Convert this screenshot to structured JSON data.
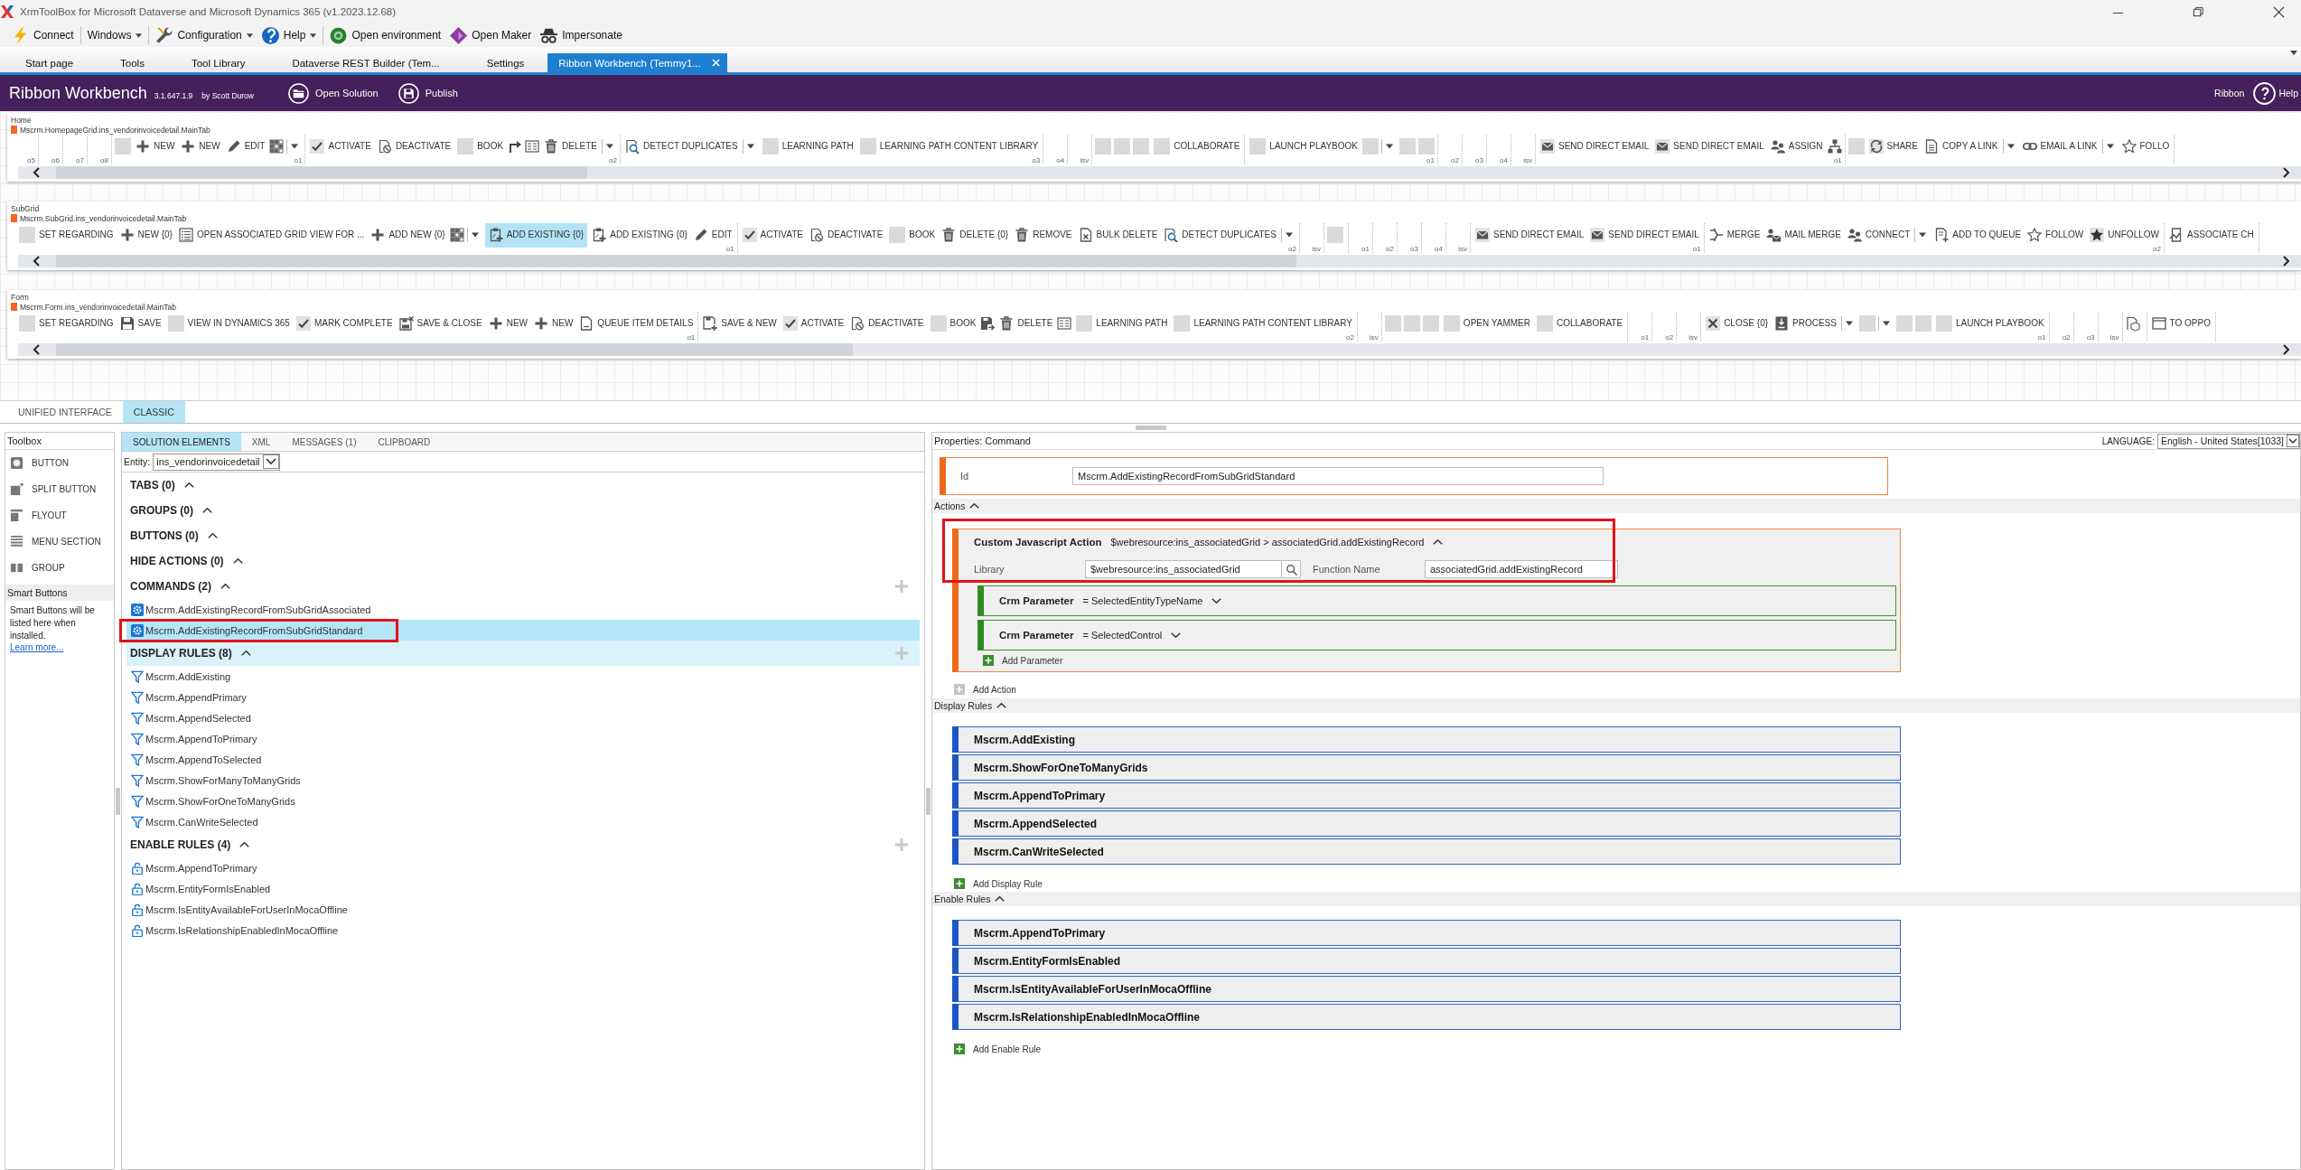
{
  "window": {
    "title": "XrmToolBox for Microsoft Dataverse and Microsoft Dynamics 365 (v1.2023.12.68)"
  },
  "toolbar": [
    {
      "items": [
        {
          "kind": "bolt",
          "label": "Connect",
          "menu": false
        }
      ]
    },
    {
      "items": [
        {
          "kind": "text",
          "label": "Windows",
          "menu": true
        }
      ]
    },
    {
      "items": [
        {
          "kind": "wrench",
          "label": "Configuration",
          "menu": true
        },
        {
          "kind": "help",
          "label": "Help",
          "menu": true
        }
      ]
    },
    {
      "items": [
        {
          "kind": "environment",
          "label": "Open environment",
          "menu": false
        },
        {
          "kind": "maker",
          "label": "Open Maker",
          "menu": false
        },
        {
          "kind": "spy",
          "label": "Impersonate",
          "menu": false
        }
      ]
    }
  ],
  "tabs": [
    {
      "label": "Start page",
      "selected": false
    },
    {
      "label": "Tools",
      "selected": false
    },
    {
      "label": "Tool Library",
      "selected": false
    },
    {
      "label": "Dataverse REST Builder (Tem...",
      "selected": false
    },
    {
      "label": "Settings",
      "selected": false
    },
    {
      "label": "Ribbon Workbench (Temmy1...",
      "selected": true
    }
  ],
  "header": {
    "title": "Ribbon Workbench",
    "version": "3.1.647.1.9",
    "author": "by Scott Durow",
    "actions": [
      {
        "kind": "open",
        "label": "Open Solution"
      },
      {
        "kind": "publish",
        "label": "Publish"
      }
    ],
    "ribbon": "Ribbon",
    "help": "Help"
  },
  "ribbon_tabs": [
    {
      "title": "Home",
      "id": "Mscrm.HomepageGrid.ins_vendorinvoicedetail.MainTab",
      "groups": [
        {
          "label": "o5"
        },
        {
          "label": "o6"
        },
        {
          "label": "o7"
        },
        {
          "label": "o8"
        },
        {
          "label": "o1",
          "items": [
            {
              "kind": "blank",
              "selected": false
            },
            {
              "kind": "plus",
              "label": "NEW",
              "selected": false
            },
            {
              "kind": "plus",
              "label": "NEW",
              "selected": false
            },
            {
              "kind": "pencil",
              "label": "EDIT",
              "selected": false
            },
            {
              "kind": "grid",
              "selected": false
            },
            {
              "kind": "caret",
              "selected": false
            }
          ]
        },
        {
          "label": "o2",
          "items": [
            {
              "kind": "check",
              "label": "ACTIVATE",
              "selected": false
            },
            {
              "kind": "deactivate",
              "label": "DEACTIVATE",
              "selected": false
            },
            {
              "kind": "blank",
              "label": "BOOK",
              "selected": false
            },
            {
              "kind": "arrow",
              "selected": false
            },
            {
              "kind": "form",
              "selected": false
            },
            {
              "kind": "trash",
              "label": "DELETE",
              "selected": false
            },
            {
              "kind": "caret",
              "selected": false
            }
          ]
        },
        {
          "label": "o3",
          "items": [
            {
              "kind": "detect",
              "label": "DETECT DUPLICATES",
              "selected": false
            },
            {
              "kind": "caret",
              "selected": false
            },
            {
              "kind": "blank",
              "label": "LEARNING PATH",
              "selected": false
            },
            {
              "kind": "blank",
              "label": "LEARNING PATH CONTENT LIBRARY",
              "selected": false
            }
          ]
        },
        {
          "label": "o4"
        },
        {
          "label": "isv"
        },
        {
          "items": [
            {
              "kind": "blank",
              "selected": false
            },
            {
              "kind": "blank",
              "selected": false
            },
            {
              "kind": "blank",
              "selected": false
            },
            {
              "kind": "blank",
              "label": "COLLABORATE",
              "selected": false
            }
          ]
        },
        {
          "label": "o1",
          "items": [
            {
              "kind": "blank",
              "label": "LAUNCH PLAYBOOK",
              "selected": false
            },
            {
              "kind": "blank",
              "selected": false
            },
            {
              "kind": "caret",
              "selected": false
            },
            {
              "kind": "blank",
              "selected": false
            },
            {
              "kind": "blank",
              "selected": false
            }
          ]
        },
        {
          "label": "o2"
        },
        {
          "label": "o3"
        },
        {
          "label": "o4"
        },
        {
          "label": "isv"
        },
        {
          "label": "o1",
          "items": [
            {
              "kind": "mail",
              "label": "SEND DIRECT EMAIL",
              "selected": false
            },
            {
              "kind": "mail",
              "label": "SEND DIRECT EMAIL",
              "selected": false
            },
            {
              "kind": "assign",
              "label": "ASSIGN",
              "selected": false
            },
            {
              "kind": "hierarchy",
              "selected": false
            }
          ]
        },
        {
          "items": [
            {
              "kind": "blank",
              "selected": false
            },
            {
              "kind": "share",
              "label": "SHARE",
              "selected": false
            },
            {
              "kind": "copy",
              "label": "COPY A LINK",
              "selected": false
            },
            {
              "kind": "caret",
              "selected": false
            },
            {
              "kind": "link",
              "label": "EMAIL A LINK",
              "selected": false
            },
            {
              "kind": "caret",
              "selected": false
            },
            {
              "kind": "star",
              "label": "FOLLO",
              "selected": false
            }
          ]
        }
      ]
    },
    {
      "title": "SubGrid",
      "id": "Mscrm.SubGrid.ins_vendorinvoicedetail.MainTab",
      "groups": [
        {
          "label": "o1",
          "items": [
            {
              "kind": "blank",
              "label": "SET REGARDING",
              "selected": false
            },
            {
              "kind": "plus",
              "label": "NEW {0}",
              "selected": false
            },
            {
              "kind": "list",
              "label": "OPEN ASSOCIATED GRID VIEW FOR ...",
              "selected": false
            },
            {
              "kind": "plus",
              "label": "ADD NEW {0}",
              "selected": false
            },
            {
              "kind": "grid",
              "selected": false
            },
            {
              "kind": "caret",
              "selected": false
            },
            {
              "kind": "clipboard",
              "label": "ADD EXISTING {0}",
              "selected": true
            },
            {
              "kind": "clipboard",
              "label": "ADD EXISTING {0}",
              "selected": false
            },
            {
              "kind": "pencil",
              "label": "EDIT",
              "selected": false
            }
          ]
        },
        {
          "label": "o2",
          "items": [
            {
              "kind": "check",
              "label": "ACTIVATE",
              "selected": false
            },
            {
              "kind": "deactivate",
              "label": "DEACTIVATE",
              "selected": false
            },
            {
              "kind": "blank",
              "label": "BOOK",
              "selected": false
            },
            {
              "kind": "trash",
              "label": "DELETE {0}",
              "selected": false
            },
            {
              "kind": "trash",
              "label": "REMOVE",
              "selected": false
            },
            {
              "kind": "bulk",
              "label": "BULK DELETE",
              "selected": false
            },
            {
              "kind": "detect",
              "label": "DETECT DUPLICATES",
              "selected": false
            },
            {
              "kind": "caret",
              "selected": false
            }
          ]
        },
        {
          "label": "isv"
        },
        {
          "items": [
            {
              "kind": "blank",
              "selected": false
            }
          ]
        },
        {
          "label": "o1"
        },
        {
          "label": "o2"
        },
        {
          "label": "o3"
        },
        {
          "label": "o4"
        },
        {
          "label": "isv"
        },
        {
          "label": "o1",
          "items": [
            {
              "kind": "mail",
              "label": "SEND DIRECT EMAIL",
              "selected": false
            },
            {
              "kind": "mail",
              "label": "SEND DIRECT EMAIL",
              "selected": false
            }
          ]
        },
        {
          "label": "o2",
          "items": [
            {
              "kind": "merge",
              "label": "MERGE",
              "selected": false
            },
            {
              "kind": "mailmerge",
              "label": "MAIL MERGE",
              "selected": false
            },
            {
              "kind": "connect",
              "label": "CONNECT",
              "selected": false
            },
            {
              "kind": "caret",
              "selected": false
            },
            {
              "kind": "queue",
              "label": "ADD TO QUEUE",
              "selected": false
            },
            {
              "kind": "star",
              "label": "FOLLOW",
              "selected": false
            },
            {
              "kind": "starfill",
              "label": "UNFOLLOW",
              "selected": false
            }
          ]
        },
        {
          "items": [
            {
              "kind": "associate",
              "label": "ASSOCIATE CH",
              "selected": false
            }
          ]
        }
      ]
    },
    {
      "title": "Form",
      "id": "Mscrm.Form.ins_vendorinvoicedetail.MainTab",
      "groups": [
        {
          "label": "o1",
          "items": [
            {
              "kind": "blank",
              "label": "SET REGARDING",
              "selected": false
            },
            {
              "kind": "save",
              "label": "SAVE",
              "selected": false
            },
            {
              "kind": "blank",
              "label": "VIEW IN DYNAMICS 365",
              "selected": false
            },
            {
              "kind": "check",
              "label": "MARK COMPLETE",
              "selected": false
            },
            {
              "kind": "saveclose",
              "label": "SAVE & CLOSE",
              "selected": false
            },
            {
              "kind": "plus",
              "label": "NEW",
              "selected": false
            },
            {
              "kind": "plus",
              "label": "NEW",
              "selected": false
            },
            {
              "kind": "doc",
              "label": "QUEUE ITEM DETAILS",
              "selected": false
            }
          ]
        },
        {
          "label": "o2",
          "items": [
            {
              "kind": "savenew",
              "label": "SAVE & NEW",
              "selected": false
            },
            {
              "kind": "check",
              "label": "ACTIVATE",
              "selected": false
            },
            {
              "kind": "deactivate",
              "label": "DEACTIVATE",
              "selected": false
            },
            {
              "kind": "blank",
              "label": "BOOK",
              "selected": false
            },
            {
              "kind": "saveas",
              "selected": false
            },
            {
              "kind": "trash",
              "label": "DELETE",
              "selected": false
            },
            {
              "kind": "form",
              "selected": false
            },
            {
              "kind": "blank",
              "label": "LEARNING PATH",
              "selected": false
            },
            {
              "kind": "blank",
              "label": "LEARNING PATH CONTENT LIBRARY",
              "selected": false
            }
          ]
        },
        {
          "label": "isv"
        },
        {
          "items": [
            {
              "kind": "blank",
              "selected": false
            },
            {
              "kind": "blank",
              "selected": false
            },
            {
              "kind": "blank",
              "selected": false
            },
            {
              "kind": "blank",
              "label": "OPEN YAMMER",
              "selected": false
            },
            {
              "kind": "blank",
              "label": "COLLABORATE",
              "selected": false
            }
          ]
        },
        {
          "label": "o1"
        },
        {
          "label": "o2"
        },
        {
          "label": "isv"
        },
        {
          "label": "o1",
          "items": [
            {
              "kind": "close",
              "label": "CLOSE {0}",
              "selected": false
            },
            {
              "kind": "process",
              "label": "PROCESS",
              "selected": false
            },
            {
              "kind": "caret",
              "selected": false
            },
            {
              "kind": "blank",
              "selected": false
            },
            {
              "kind": "caret",
              "selected": false
            },
            {
              "kind": "blank",
              "selected": false
            },
            {
              "kind": "blank",
              "selected": false
            },
            {
              "kind": "blank",
              "label": "LAUNCH PLAYBOOK",
              "selected": false
            }
          ]
        },
        {
          "label": "o2"
        },
        {
          "label": "o3"
        },
        {
          "label": "isv"
        },
        {
          "items": [
            {
              "kind": "box",
              "selected": false
            }
          ]
        },
        {
          "items": [
            {
              "kind": "window",
              "label": "TO OPPO",
              "selected": false
            }
          ]
        }
      ]
    }
  ],
  "mode_tabs": [
    {
      "label": "UNIFIED INTERFACE",
      "selected": false
    },
    {
      "label": "CLASSIC",
      "selected": true
    }
  ],
  "toolbox": {
    "title": "Toolbox",
    "items": [
      {
        "kind": "button",
        "label": "BUTTON"
      },
      {
        "kind": "split",
        "label": "SPLIT BUTTON"
      },
      {
        "kind": "flyout",
        "label": "FLYOUT"
      },
      {
        "kind": "menu",
        "label": "MENU SECTION"
      },
      {
        "kind": "group",
        "label": "GROUP"
      }
    ],
    "smart_buttons": {
      "title": "Smart Buttons",
      "text": "Smart Buttons will be listed here when installed.",
      "link": "Learn more..."
    }
  },
  "solution_panel": {
    "tabs": [
      {
        "label": "SOLUTION ELEMENTS",
        "selected": true
      },
      {
        "label": "XML",
        "selected": false
      },
      {
        "label": "MESSAGES (1)",
        "selected": false
      },
      {
        "label": "CLIPBOARD",
        "selected": false
      }
    ],
    "entity": {
      "label": "Entity:",
      "value": "ins_vendorinvoicedetail"
    },
    "sections": [
      {
        "title": "TABS (0)",
        "expanded": true,
        "highlighted": false,
        "add_button": false
      },
      {
        "title": "GROUPS (0)",
        "expanded": true,
        "highlighted": false,
        "add_button": false
      },
      {
        "title": "BUTTONS (0)",
        "expanded": true,
        "highlighted": false,
        "add_button": false
      },
      {
        "title": "HIDE ACTIONS (0)",
        "expanded": true,
        "highlighted": false,
        "add_button": false
      },
      {
        "kind": "command",
        "title": "COMMANDS (2)",
        "expanded": true,
        "highlighted": false,
        "add_button": true,
        "items": [
          {
            "label": "Mscrm.AddExistingRecordFromSubGridAssociated",
            "selected": false,
            "annotated": false
          },
          {
            "label": "Mscrm.AddExistingRecordFromSubGridStandard",
            "selected": true,
            "annotated": true
          }
        ]
      },
      {
        "kind": "display_rule",
        "title": "DISPLAY RULES (8)",
        "expanded": true,
        "highlighted": true,
        "add_button": true,
        "items": [
          {
            "label": "Mscrm.AddExisting",
            "selected": false,
            "annotated": false
          },
          {
            "label": "Mscrm.AppendPrimary",
            "selected": false,
            "annotated": false
          },
          {
            "label": "Mscrm.AppendSelected",
            "selected": false,
            "annotated": false
          },
          {
            "label": "Mscrm.AppendToPrimary",
            "selected": false,
            "annotated": false
          },
          {
            "label": "Mscrm.AppendToSelected",
            "selected": false,
            "annotated": false
          },
          {
            "label": "Mscrm.ShowForManyToManyGrids",
            "selected": false,
            "annotated": false
          },
          {
            "label": "Mscrm.ShowForOneToManyGrids",
            "selected": false,
            "annotated": false
          },
          {
            "label": "Mscrm.CanWriteSelected",
            "selected": false,
            "annotated": false
          }
        ]
      },
      {
        "kind": "enable_rule",
        "title": "ENABLE RULES (4)",
        "expanded": true,
        "highlighted": false,
        "add_button": true,
        "items": [
          {
            "label": "Mscrm.AppendToPrimary",
            "selected": false,
            "annotated": false
          },
          {
            "label": "Mscrm.EntityFormIsEnabled",
            "selected": false,
            "annotated": false
          },
          {
            "label": "Mscrm.IsEntityAvailableForUserInMocaOffline",
            "selected": false,
            "annotated": false
          },
          {
            "label": "Mscrm.IsRelationshipEnabledInMocaOffline",
            "selected": false,
            "annotated": false
          }
        ]
      }
    ]
  },
  "properties": {
    "title": "Properties: Command",
    "language": {
      "label": "LANGUAGE:",
      "value": "English - United States[1033]"
    },
    "id": {
      "label": "Id",
      "value": "Mscrm.AddExistingRecordFromSubGridStandard"
    },
    "actions": {
      "title": "Actions",
      "expanded": true,
      "items": [
        {
          "title": "Custom Javascript Action",
          "summary": "$webresource:ins_associatedGrid > associatedGrid.addExistingRecord",
          "expanded": true,
          "annotated": true,
          "library": {
            "label": "Library",
            "value": "$webresource:ins_associatedGrid"
          },
          "function": {
            "label": "Function Name",
            "value": "associatedGrid.addExistingRecord"
          },
          "parameters": [
            {
              "label": "Crm Parameter",
              "value": "= SelectedEntityTypeName",
              "expanded": false
            },
            {
              "label": "Crm Parameter",
              "value": "= SelectedControl",
              "expanded": false
            }
          ],
          "add_parameter": "Add Parameter"
        }
      ],
      "add": "Add Action"
    },
    "display_rules": {
      "title": "Display Rules",
      "expanded": true,
      "items": [
        "Mscrm.AddExisting",
        "Mscrm.ShowForOneToManyGrids",
        "Mscrm.AppendToPrimary",
        "Mscrm.AppendSelected",
        "Mscrm.CanWriteSelected"
      ],
      "add": "Add Display Rule"
    },
    "enable_rules": {
      "title": "Enable Rules",
      "expanded": true,
      "items": [
        "Mscrm.AppendToPrimary",
        "Mscrm.EntityFormIsEnabled",
        "Mscrm.IsEntityAvailableForUserInMocaOffline",
        "Mscrm.IsRelationshipEnabledInMocaOffline"
      ],
      "add": "Add Enable Rule"
    }
  }
}
